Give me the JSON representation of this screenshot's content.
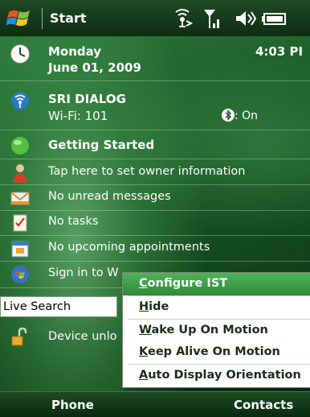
{
  "status_bar": {
    "start_label": "Start"
  },
  "today": {
    "day": "Monday",
    "date": "June 01, 2009",
    "time": "4:03 PI",
    "sri_title": "SRI DIALOG",
    "wifi": "Wi-Fi: 101",
    "bluetooth_status": ": On",
    "getting_started": "Getting Started",
    "owner_info": "Tap here to set owner information",
    "messages": "No unread messages",
    "tasks": "No tasks",
    "appointments": "No upcoming appointments",
    "sign_in": "Sign in to W",
    "search_value": "Live Search",
    "device_lock": "Device unlo"
  },
  "context_menu": {
    "items": [
      {
        "accel": "C",
        "rest": "onfigure IST",
        "selected": true
      },
      {
        "accel": "H",
        "rest": "ide",
        "selected": false
      },
      {
        "accel": "W",
        "rest": "ake Up On Motion",
        "selected": false
      },
      {
        "accel": "K",
        "rest": "eep Alive On Motion",
        "selected": false
      },
      {
        "accel": "A",
        "rest": "uto Display Orientation",
        "selected": false
      }
    ]
  },
  "soft_keys": {
    "left": "Phone",
    "right": "Contacts"
  }
}
